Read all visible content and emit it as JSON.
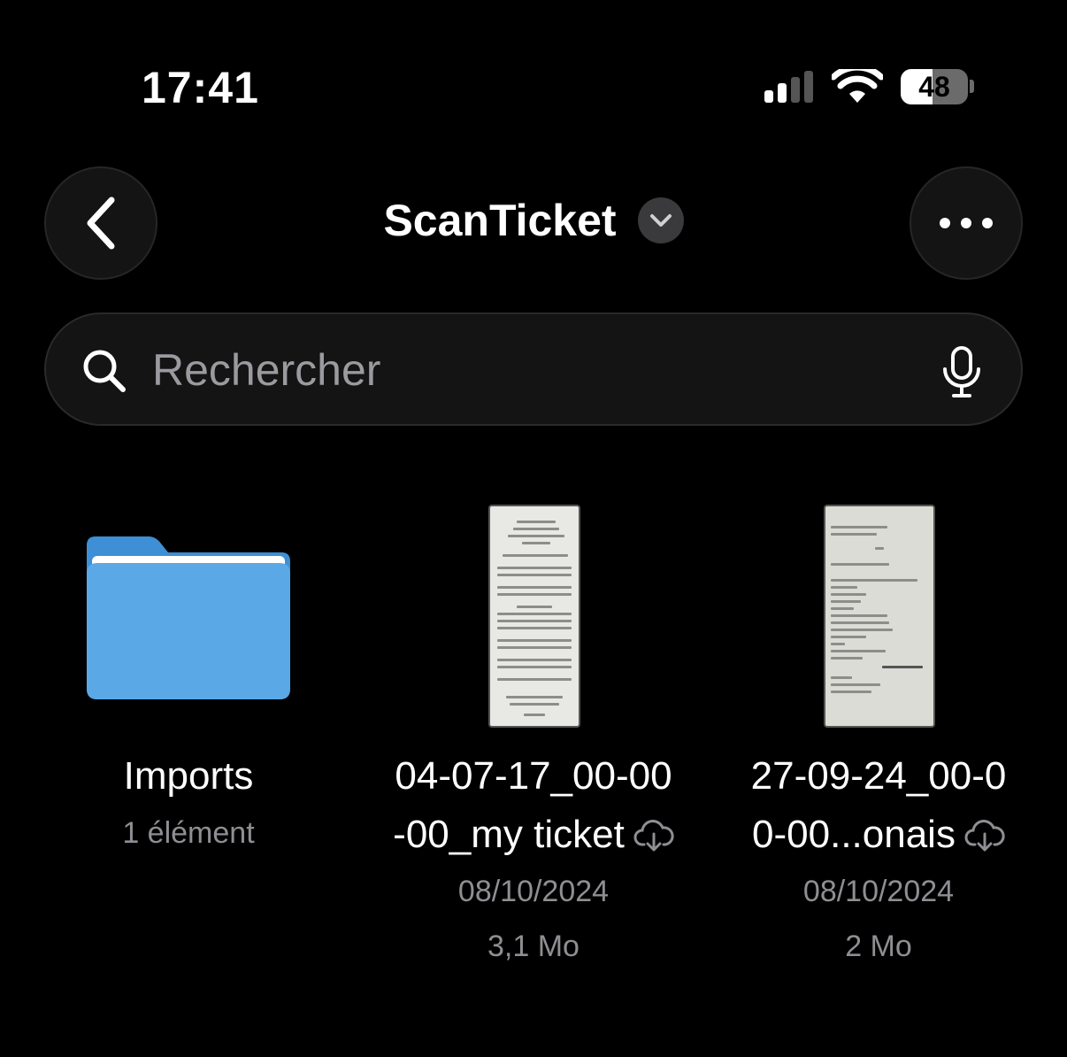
{
  "status_bar": {
    "time": "17:41",
    "battery_percent": "48",
    "battery_level": 0.48,
    "signal_bars": 2
  },
  "header": {
    "title": "ScanTicket",
    "back_icon": "chevron-left-icon",
    "more_icon": "ellipsis-icon"
  },
  "search": {
    "placeholder": "Rechercher"
  },
  "items": [
    {
      "name": "Imports",
      "meta1": "1 élément",
      "type": "folder"
    },
    {
      "name_line1": "04-07-17_00-00",
      "name_line2": "-00_my ticket",
      "date": "08/10/2024",
      "size": "3,1 Mo",
      "type": "file",
      "cloud": true
    },
    {
      "name_line1": "27-09-24_00-0",
      "name_line2": "0-00...onais",
      "date": "08/10/2024",
      "size": "2 Mo",
      "type": "file",
      "cloud": true
    }
  ],
  "colors": {
    "folder": "#5aa8e6",
    "folder_top": "#3f8fd6",
    "secondary_text": "#8e8e93"
  }
}
